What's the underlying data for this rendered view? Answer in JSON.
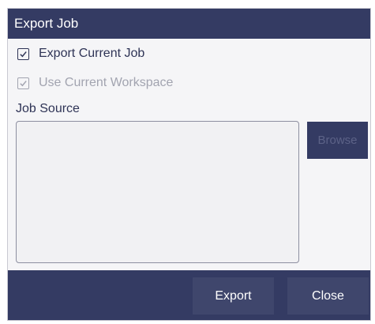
{
  "dialog": {
    "title": "Export Job",
    "export_current_job": {
      "label": "Export Current Job",
      "checked": true,
      "enabled": true
    },
    "use_current_workspace": {
      "label": "Use Current Workspace",
      "checked": true,
      "enabled": false
    },
    "job_source": {
      "label": "Job Source",
      "value": ""
    },
    "browse_label": "Browse",
    "export_label": "Export",
    "close_label": "Close"
  },
  "colors": {
    "primary": "#343b63",
    "button": "#3f466c",
    "text": "#2f3456",
    "disabled_text": "#a2a4b0",
    "background": "#f5f5f7"
  },
  "icons": {
    "checkbox_checked": "check-icon"
  }
}
